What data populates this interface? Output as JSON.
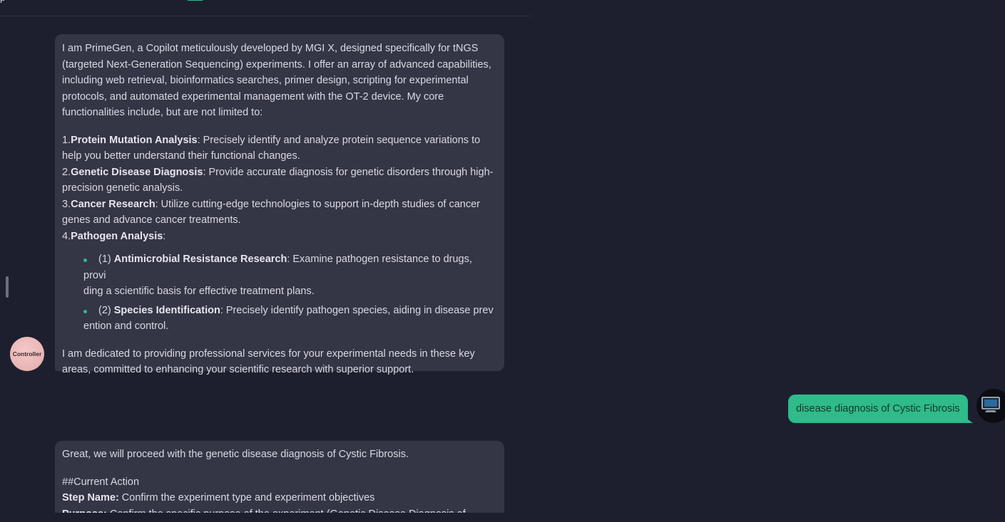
{
  "header": {
    "fragment_text": "p"
  },
  "messages": [
    {
      "role": "assistant",
      "avatar_label": "Controller",
      "intro": "I am PrimeGen, a Copilot meticulously developed by MGI X, designed specifically for tNGS (targeted Next-Generation Sequencing) experiments. I offer an array of advanced capabilities, including web retrieval, bioinformatics searches, primer design, scripting for experimental protocols, and automated experimental management with the OT-2 device. My core functionalities include, but are not limited to:",
      "capabilities": [
        {
          "num": "1.",
          "title": "Protein Mutation Analysis",
          "desc": ": Precisely identify and analyze protein sequence variations to help you better understand their functional changes."
        },
        {
          "num": "2.",
          "title": "Genetic Disease Diagnosis",
          "desc": ": Provide accurate diagnosis for genetic disorders through high-precision genetic analysis."
        },
        {
          "num": "3.",
          "title": "Cancer Research",
          "desc": ": Utilize cutting-edge technologies to support in-depth studies of cancer genes and advance cancer treatments."
        },
        {
          "num": "4.",
          "title": "Pathogen Analysis",
          "desc": ":"
        }
      ],
      "sub_items": [
        {
          "prefix": "(1) ",
          "title": "Antimicrobial Resistance Research",
          "desc_line1": ": Examine pathogen resistance to drugs, provi",
          "desc_line2": "ding a scientific basis for effective treatment plans."
        },
        {
          "prefix": "(2) ",
          "title": "Species Identification",
          "desc_line1": ": Precisely identify pathogen species, aiding in disease prev",
          "desc_line2": "ention and control."
        }
      ],
      "closing": "I am dedicated to providing professional services for your experimental needs in these key areas, committed to enhancing your scientific research with superior support."
    },
    {
      "role": "user",
      "text": "disease diagnosis of Cystic Fibrosis",
      "avatar_icon": "monitor-icon"
    },
    {
      "role": "assistant",
      "intro": "Great, we will proceed with the genetic disease diagnosis of Cystic Fibrosis.",
      "section_heading": "##Current Action",
      "step_label": "Step Name:",
      "step_value": " Confirm the experiment type and experiment objectives",
      "purpose_label": "Purpose:",
      "purpose_value": " Confirm the specific purpose of the experiment (Genetic Disease Diagnosis of"
    }
  ],
  "colors": {
    "background": "#1e1f2e",
    "assistant_bubble": "#343545",
    "user_bubble": "#2fbb8a",
    "bullet": "#2fbb8a"
  }
}
